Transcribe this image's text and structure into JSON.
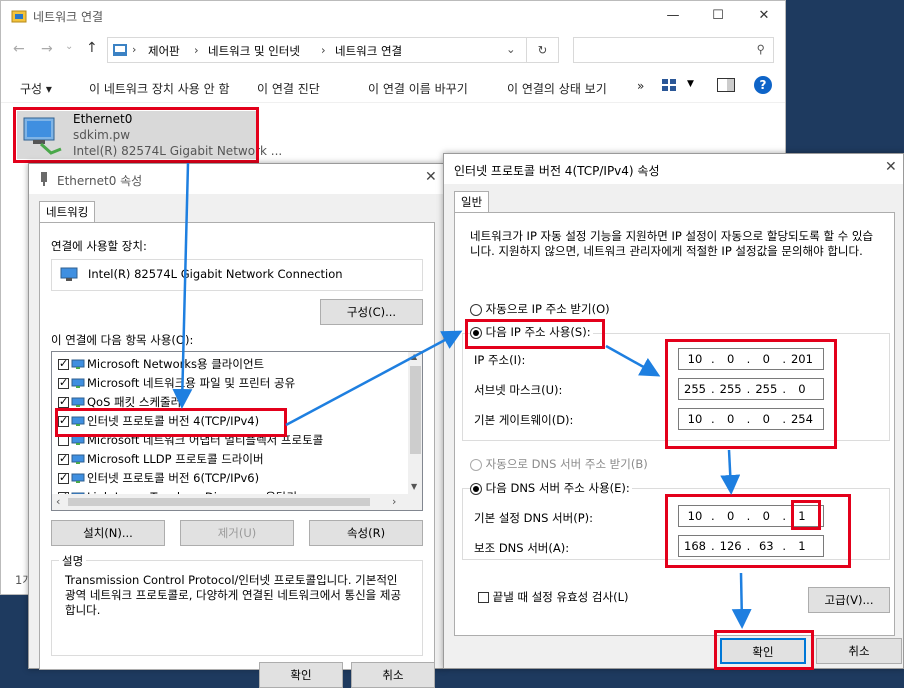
{
  "explorer": {
    "title": "네트워크 연결",
    "breadcrumb": [
      "제어판",
      "네트워크 및 인터넷",
      "네트워크 연결"
    ],
    "commands": [
      "구성 ▾",
      "이 네트워크 장치 사용 안 함",
      "이 연결 진단",
      "이 연결 이름 바꾸기",
      "이 연결의 상태 보기",
      "»"
    ],
    "adapter": {
      "name": "Ethernet0",
      "network": "sdkim.pw",
      "device": "Intel(R) 82574L Gigabit Network ..."
    },
    "status_text": "1개"
  },
  "eth_props": {
    "title": "Ethernet0 속성",
    "tab": "네트워킹",
    "connect_using_label": "연결에 사용할 장치:",
    "device_name": "Intel(R) 82574L Gigabit Network Connection",
    "configure_button": "구성(C)...",
    "items_label": "이 연결에 다음 항목 사용(O):",
    "items": [
      {
        "label": "Microsoft Networks용 클라이언트",
        "checked": true
      },
      {
        "label": "Microsoft 네트워크용 파일 및 프린터 공유",
        "checked": true
      },
      {
        "label": "QoS 패킷 스케줄러",
        "checked": true
      },
      {
        "label": "인터넷 프로토콜 버전 4(TCP/IPv4)",
        "checked": true
      },
      {
        "label": "Microsoft 네트워크 어댑터 멀티플렉서 프로토콜",
        "checked": false
      },
      {
        "label": "Microsoft LLDP 프로토콜 드라이버",
        "checked": true
      },
      {
        "label": "인터넷 프로토콜 버전 6(TCP/IPv6)",
        "checked": true
      },
      {
        "label": "Link-Layer Topology Discovery 응답기",
        "checked": true
      }
    ],
    "install_button": "설치(N)...",
    "remove_button": "제거(U)",
    "properties_button": "속성(R)",
    "description_title": "설명",
    "description": "Transmission Control Protocol/인터넷 프로토콜입니다. 기본적인 광역 네트워크 프로토콜로, 다양하게 연결된 네트워크에서 통신을 제공합니다.",
    "ok_button": "확인",
    "cancel_button": "취소"
  },
  "ipv4": {
    "title": "인터넷 프로토콜 버전 4(TCP/IPv4) 속성",
    "tab": "일반",
    "intro": "네트워크가 IP 자동 설정 기능을 지원하면 IP 설정이 자동으로 할당되도록 할 수 있습니다. 지원하지 않으면, 네트워크 관리자에게 적절한 IP 설정값을 문의해야 합니다.",
    "auto_ip": "자동으로 IP 주소 받기(O)",
    "manual_ip": "다음 IP 주소 사용(S):",
    "ip_label": "IP 주소(I):",
    "ip": [
      "10",
      "0",
      "0",
      "201"
    ],
    "mask_label": "서브넷 마스크(U):",
    "mask": [
      "255",
      "255",
      "255",
      "0"
    ],
    "gw_label": "기본 게이트웨이(D):",
    "gw": [
      "10",
      "0",
      "0",
      "254"
    ],
    "auto_dns": "자동으로 DNS 서버 주소 받기(B)",
    "manual_dns": "다음 DNS 서버 주소 사용(E):",
    "dns1_label": "기본 설정 DNS 서버(P):",
    "dns1": [
      "10",
      "0",
      "0",
      "1"
    ],
    "dns2_label": "보조 DNS 서버(A):",
    "dns2": [
      "168",
      "126",
      "63",
      "1"
    ],
    "validate_label": "끝낼 때 설정 유효성 검사(L)",
    "advanced_button": "고급(V)...",
    "ok_button": "확인",
    "cancel_button": "취소"
  },
  "colors": {
    "highlight_red": "#e3001b",
    "arrow_blue": "#1e7fe0"
  }
}
